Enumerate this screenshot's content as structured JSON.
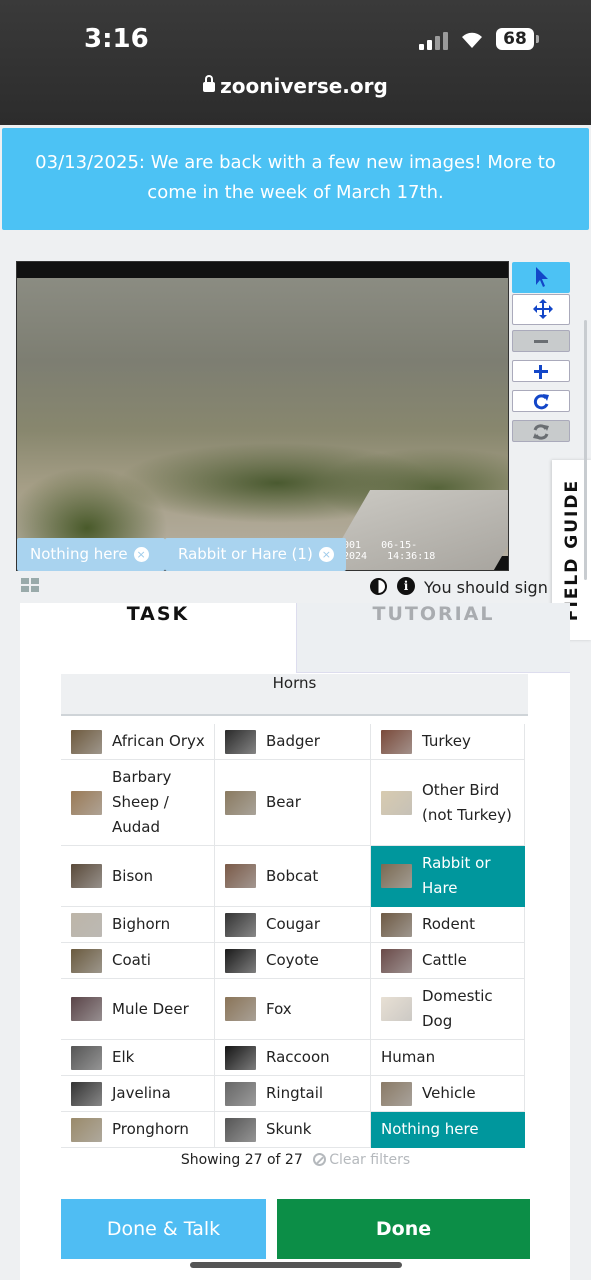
{
  "status": {
    "time": "3:16",
    "battery": "68",
    "url": "zooniverse.org"
  },
  "banner": {
    "text": "03/13/2025: We are back with a few new images! More to come in the week of March 17th."
  },
  "subject": {
    "camera_id": "001",
    "date": "06-15-2024",
    "time": "14:36:18"
  },
  "toolbar": {
    "icons": [
      "pointer-icon",
      "move-icon",
      "zoom-out-icon",
      "zoom-in-icon",
      "rotate-icon",
      "reset-icon"
    ]
  },
  "annotations": {
    "chips": [
      {
        "label": "Nothing here"
      },
      {
        "label": "Rabbit or Hare (1)"
      }
    ]
  },
  "sign_in_notice": "You should sign",
  "field_guide": {
    "label": "FIELD GUIDE"
  },
  "tabs": {
    "task": "TASK",
    "tutorial": "TUTORIAL"
  },
  "filter": {
    "label": "Horns"
  },
  "choices": [
    {
      "label": "African Oryx",
      "thumb": "#6e5a3e"
    },
    {
      "label": "Badger",
      "thumb": "#2a2a2a"
    },
    {
      "label": "Turkey",
      "thumb": "#7a4a3a"
    },
    {
      "label": "Barbary Sheep / Audad",
      "thumb": "#9a7a56"
    },
    {
      "label": "Bear",
      "thumb": "#8a7a60"
    },
    {
      "label": "Other Bird (not Turkey)",
      "thumb": "#d8cbb0"
    },
    {
      "label": "Bison",
      "thumb": "#5a4a3a"
    },
    {
      "label": "Bobcat",
      "thumb": "#7a5a48"
    },
    {
      "label": "Rabbit or Hare",
      "thumb": "#7a6a52",
      "selected": true
    },
    {
      "label": "Bighorn",
      "thumb": "#bdb5a8"
    },
    {
      "label": "Cougar",
      "thumb": "#333"
    },
    {
      "label": "Rodent",
      "thumb": "#6e5a44"
    },
    {
      "label": "Coati",
      "thumb": "#6a5a3e"
    },
    {
      "label": "Coyote",
      "thumb": "#1a1a1a"
    },
    {
      "label": "Cattle",
      "thumb": "#6a4a48"
    },
    {
      "label": "Mule Deer",
      "thumb": "#5a4448"
    },
    {
      "label": "Fox",
      "thumb": "#8a7458"
    },
    {
      "label": "Domestic Dog",
      "thumb": "#e8e0d4"
    },
    {
      "label": "Elk",
      "thumb": "#555"
    },
    {
      "label": "Raccoon",
      "thumb": "#151515"
    },
    {
      "label": "Human",
      "thumb": ""
    },
    {
      "label": "Javelina",
      "thumb": "#333"
    },
    {
      "label": "Ringtail",
      "thumb": "#666"
    },
    {
      "label": "Vehicle",
      "thumb": "#8a7a66"
    },
    {
      "label": "Pronghorn",
      "thumb": "#9a8a6a"
    },
    {
      "label": "Skunk",
      "thumb": "#555"
    },
    {
      "label": "Nothing here",
      "thumb": "",
      "selected": true
    }
  ],
  "showing": {
    "text": "Showing 27 of 27",
    "clear": "Clear filters"
  },
  "buttons": {
    "done_talk": "Done & Talk",
    "done": "Done"
  },
  "colors": {
    "banner": "#4cc2f4",
    "selected": "#00979d",
    "done": "#0c8e47",
    "done_talk": "#4fbdf3"
  }
}
